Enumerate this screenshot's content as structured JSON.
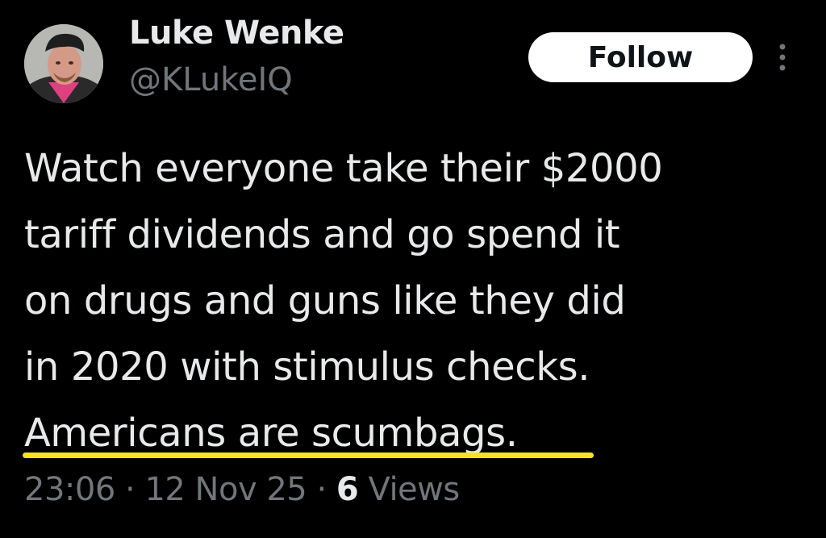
{
  "author": {
    "display_name": "Luke Wenke",
    "handle": "@KLukeIQ",
    "avatar_icon": "profile-photo"
  },
  "actions": {
    "follow_label": "Follow",
    "more_icon": "vertical-ellipsis-icon"
  },
  "tweet": {
    "lines": [
      "Watch everyone take their $2000",
      "tariff dividends and go spend it",
      "on drugs and guns like they did",
      "in 2020 with stimulus checks.",
      "Americans are scumbags."
    ],
    "highlight_color": "#f7e321"
  },
  "meta": {
    "time": "23:06",
    "separator": "·",
    "date": "12 Nov 25",
    "views_count": "6",
    "views_label": "Views"
  },
  "colors": {
    "background": "#000000",
    "text_primary": "#e7e9ea",
    "text_secondary": "#71767b",
    "button_bg": "#ffffff"
  }
}
